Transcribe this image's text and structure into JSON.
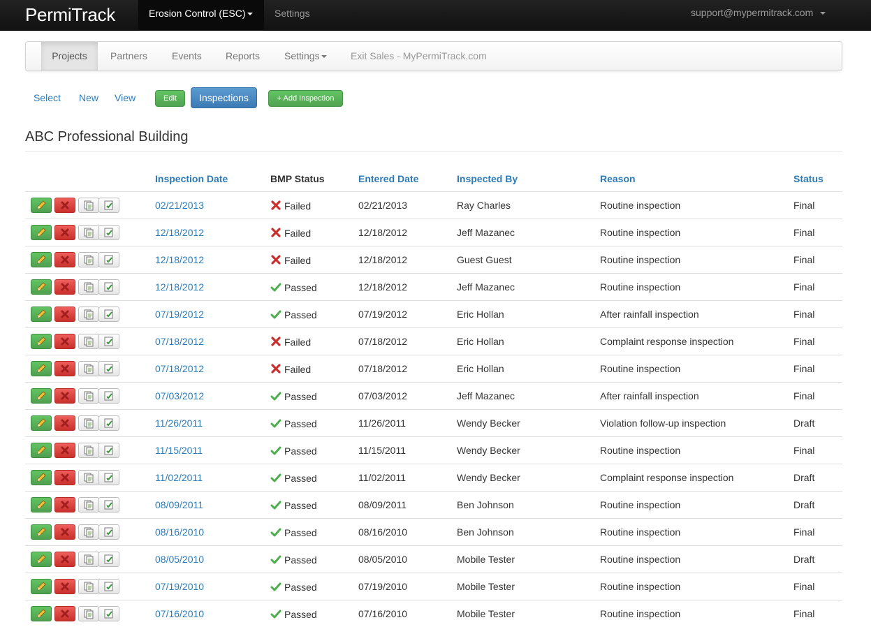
{
  "topbar": {
    "brand": "PermiTrack",
    "module_label": "Erosion Control (ESC)",
    "settings_label": "Settings",
    "user_email": "support@mypermitrack.com"
  },
  "subnav": {
    "tabs": [
      {
        "label": "Projects"
      },
      {
        "label": "Partners"
      },
      {
        "label": "Events"
      },
      {
        "label": "Reports"
      },
      {
        "label": "Settings"
      },
      {
        "label": "Exit Sales - MyPermiTrack.com"
      }
    ]
  },
  "actions": {
    "select_label": "Select",
    "new_label": "New",
    "view_label": "View",
    "edit_label": "Edit",
    "inspections_label": "Inspections",
    "add_inspection_label": "+ Add Inspection"
  },
  "page": {
    "title": "ABC Professional Building"
  },
  "table": {
    "headers": {
      "inspection_date": "Inspection Date",
      "bmp_status": "BMP Status",
      "entered_date": "Entered Date",
      "inspected_by": "Inspected By",
      "reason": "Reason",
      "status": "Status"
    },
    "rows": [
      {
        "inspection_date": "02/21/2013",
        "bmp": "Failed",
        "entered": "02/21/2013",
        "by": "Ray Charles",
        "reason": "Routine inspection",
        "status": "Final"
      },
      {
        "inspection_date": "12/18/2012",
        "bmp": "Failed",
        "entered": "12/18/2012",
        "by": "Jeff Mazanec",
        "reason": "Routine inspection",
        "status": "Final"
      },
      {
        "inspection_date": "12/18/2012",
        "bmp": "Failed",
        "entered": "12/18/2012",
        "by": "Guest Guest",
        "reason": "Routine inspection",
        "status": "Final"
      },
      {
        "inspection_date": "12/18/2012",
        "bmp": "Passed",
        "entered": "12/18/2012",
        "by": "Jeff Mazanec",
        "reason": "Routine inspection",
        "status": "Final"
      },
      {
        "inspection_date": "07/19/2012",
        "bmp": "Passed",
        "entered": "07/19/2012",
        "by": "Eric Hollan",
        "reason": "After rainfall inspection",
        "status": "Final"
      },
      {
        "inspection_date": "07/18/2012",
        "bmp": "Failed",
        "entered": "07/18/2012",
        "by": "Eric Hollan",
        "reason": "Complaint response inspection",
        "status": "Final"
      },
      {
        "inspection_date": "07/18/2012",
        "bmp": "Failed",
        "entered": "07/18/2012",
        "by": "Eric Hollan",
        "reason": "Routine inspection",
        "status": "Final"
      },
      {
        "inspection_date": "07/03/2012",
        "bmp": "Passed",
        "entered": "07/03/2012",
        "by": "Jeff Mazanec",
        "reason": "After rainfall inspection",
        "status": "Final"
      },
      {
        "inspection_date": "11/26/2011",
        "bmp": "Passed",
        "entered": "11/26/2011",
        "by": "Wendy Becker",
        "reason": "Violation follow-up inspection",
        "status": "Draft"
      },
      {
        "inspection_date": "11/15/2011",
        "bmp": "Passed",
        "entered": "11/15/2011",
        "by": "Wendy Becker",
        "reason": "Routine inspection",
        "status": "Final"
      },
      {
        "inspection_date": "11/02/2011",
        "bmp": "Passed",
        "entered": "11/02/2011",
        "by": "Wendy Becker",
        "reason": "Complaint response inspection",
        "status": "Draft"
      },
      {
        "inspection_date": "08/09/2011",
        "bmp": "Passed",
        "entered": "08/09/2011",
        "by": "Ben Johnson",
        "reason": "Routine inspection",
        "status": "Draft"
      },
      {
        "inspection_date": "08/16/2010",
        "bmp": "Passed",
        "entered": "08/16/2010",
        "by": "Ben Johnson",
        "reason": "Routine inspection",
        "status": "Final"
      },
      {
        "inspection_date": "08/05/2010",
        "bmp": "Passed",
        "entered": "08/05/2010",
        "by": "Mobile Tester",
        "reason": "Routine inspection",
        "status": "Draft"
      },
      {
        "inspection_date": "07/19/2010",
        "bmp": "Passed",
        "entered": "07/19/2010",
        "by": "Mobile Tester",
        "reason": "Routine inspection",
        "status": "Final"
      },
      {
        "inspection_date": "07/16/2010",
        "bmp": "Passed",
        "entered": "07/16/2010",
        "by": "Mobile Tester",
        "reason": "Routine inspection",
        "status": "Final"
      }
    ]
  }
}
